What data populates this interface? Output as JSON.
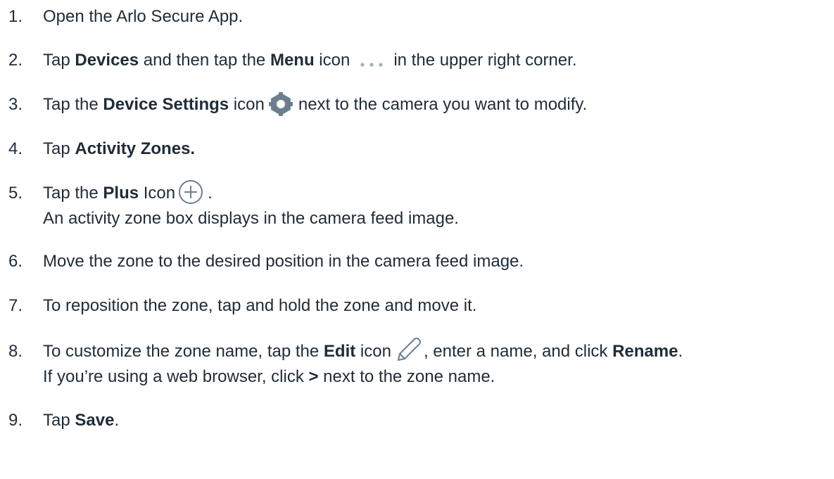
{
  "steps": [
    {
      "number": "1.",
      "parts": [
        "Open the Arlo Secure App."
      ]
    },
    {
      "number": "2.",
      "parts": [
        "Tap ",
        "Devices",
        " and then tap the ",
        "Menu",
        " icon",
        "in the  upper right corner."
      ]
    },
    {
      "number": "3.",
      "parts": [
        "Tap the ",
        "Device Settings",
        " icon",
        "next to the camera you want to modify."
      ]
    },
    {
      "number": "4.",
      "parts": [
        "Tap ",
        "Activity Zones."
      ]
    },
    {
      "number": "5.",
      "parts": [
        "Tap the ",
        "Plus",
        " Icon",
        "."
      ],
      "line2": "An activity zone box displays in the camera feed image."
    },
    {
      "number": "6.",
      "parts": [
        "Move the zone to the desired position in the camera feed image."
      ]
    },
    {
      "number": "7.",
      "parts": [
        "To reposition the zone, tap and hold the zone and move it."
      ]
    },
    {
      "number": "8.",
      "parts": [
        "To customize the zone name, tap the ",
        "Edit",
        " icon",
        ", enter a name, and click ",
        "Rename",
        "."
      ],
      "line2_parts": [
        "If you’re using a web browser, click ",
        ">",
        " next to the zone name."
      ]
    },
    {
      "number": "9.",
      "parts": [
        "Tap ",
        "Save",
        "."
      ]
    }
  ],
  "icons": {
    "menu": "ellipsis-icon",
    "settings": "gear-icon",
    "plus": "plus-circle-icon",
    "edit": "pencil-icon"
  },
  "colors": {
    "text": "#1f2c38",
    "icon": "#6b7f8e",
    "dots": "#a3aeb8"
  }
}
